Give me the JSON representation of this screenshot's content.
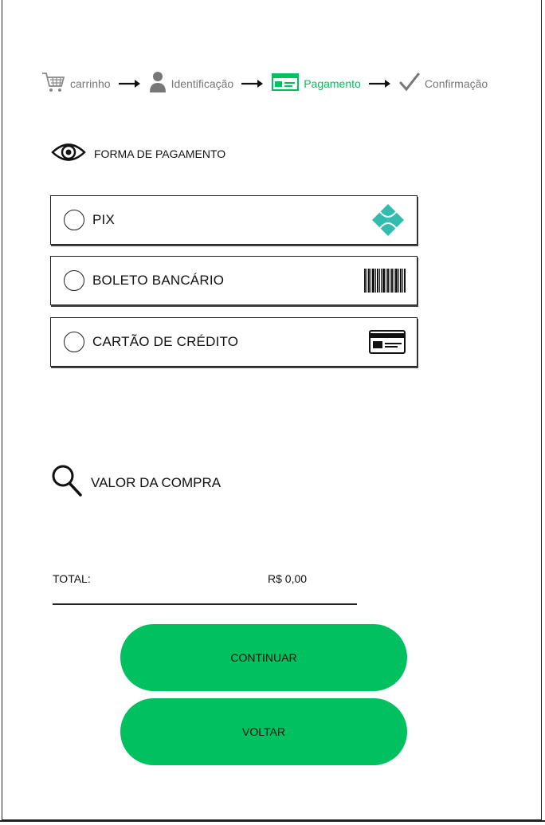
{
  "stepper": {
    "steps": [
      {
        "label": "carrinho",
        "icon": "cart-icon",
        "active": false
      },
      {
        "label": "Identificação",
        "icon": "user-icon",
        "active": false
      },
      {
        "label": "Pagamento",
        "icon": "credit-card-icon",
        "active": true
      },
      {
        "label": "Confirmação",
        "icon": "check-icon",
        "active": false
      }
    ],
    "colors": {
      "active": "#00c060",
      "inactive": "#777777"
    }
  },
  "payment_section": {
    "title": "FORMA DE PAGAMENTO",
    "icon": "eye-icon",
    "options": [
      {
        "label": "PIX",
        "icon": "pix-icon",
        "selected": false
      },
      {
        "label": "BOLETO BANCÁRIO",
        "icon": "barcode-icon",
        "selected": false
      },
      {
        "label": "CARTÃO DE CRÉDITO",
        "icon": "credit-card-icon",
        "selected": false
      }
    ]
  },
  "summary_section": {
    "title": "VALOR DA COMPRA",
    "icon": "search-icon",
    "total_label": "TOTAL:",
    "total_value": "R$ 0,00"
  },
  "buttons": {
    "continue_label": "CONTINUAR",
    "back_label": "VOLTAR",
    "color": "#00c060"
  }
}
